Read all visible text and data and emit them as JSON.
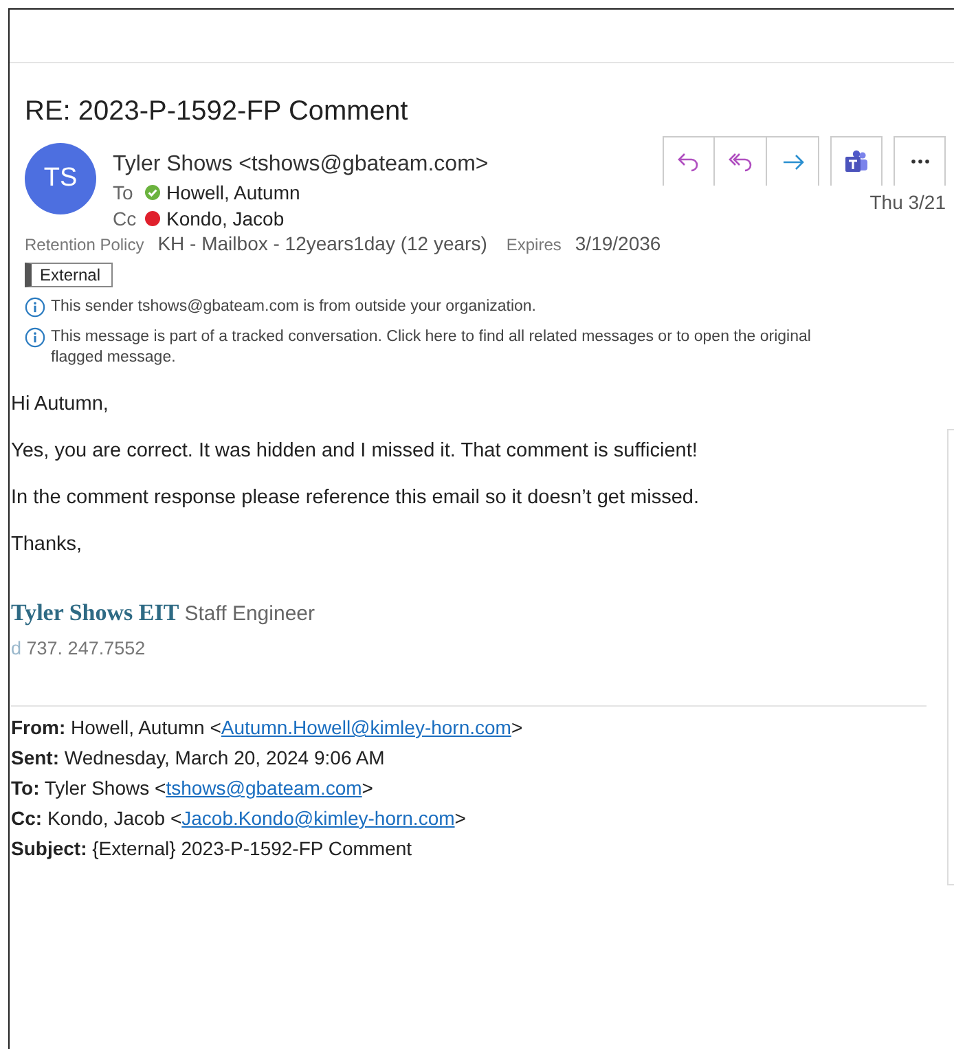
{
  "subject": "RE: 2023-P-1592-FP Comment",
  "sender": {
    "initials": "TS",
    "display": "Tyler Shows <tshows@gbateam.com>"
  },
  "recipients": [
    {
      "label": "To",
      "name": "Howell, Autumn",
      "color": "#6bb33e"
    },
    {
      "label": "Cc",
      "name": "Kondo, Jacob",
      "color": "#e0202c"
    }
  ],
  "date": "Thu 3/21",
  "retention": {
    "label": "Retention Policy",
    "value": "KH - Mailbox - 12years1day (12 years)",
    "expires_label": "Expires",
    "expires": "3/19/2036"
  },
  "tag": "External",
  "notices": [
    "This sender tshows@gbateam.com is from outside your organization.",
    "This message is part of a tracked conversation. Click here to find all related messages or to open the original flagged message."
  ],
  "body": [
    "Hi Autumn,",
    "Yes, you are correct. It was hidden and I missed it. That comment is sufficient!",
    "In the comment response please reference this email so it doesn’t get missed.",
    "Thanks,"
  ],
  "signature": {
    "name": "Tyler Shows EIT",
    "title": "Staff Engineer",
    "phone_prefix": "d",
    "phone": "737. 247.7552"
  },
  "quoted": [
    {
      "label": "From:",
      "text": "Howell, Autumn <",
      "email": "Autumn.Howell@kimley-horn.com",
      "after": ">"
    },
    {
      "label": "Sent:",
      "text": "Wednesday, March 20, 2024 9:06 AM"
    },
    {
      "label": "To:",
      "text": "Tyler Shows <",
      "email": "tshows@gbateam.com",
      "after": ">"
    },
    {
      "label": "Cc:",
      "text": "Kondo, Jacob <",
      "email": "Jacob.Kondo@kimley-horn.com",
      "after": ">"
    },
    {
      "label": "Subject:",
      "text": "{External} 2023-P-1592-FP Comment"
    }
  ]
}
